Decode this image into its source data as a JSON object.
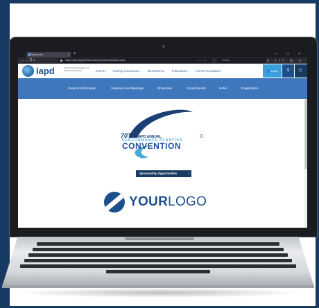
{
  "browser": {
    "tab_title": "Sponsors",
    "tab_close": "×",
    "new_tab": "+",
    "window_controls": "– □ ×",
    "nav_controls": "← → C ⌂",
    "url": "https://iapd.org/2020AnnualConvention/Sponsors.aspx",
    "url_actions": "··· ♡ ☆",
    "search_placeholder": "Search",
    "toolbar_icons": "⇓ ||| ◫ ≡"
  },
  "site": {
    "logo_text": "iapd",
    "org_name": "International Association of Plastics Distribution",
    "menu": [
      "Events ›",
      "Training & Education ›",
      "Membership ›",
      "Publications ›",
      "COVID-19 Updates"
    ],
    "login_label": "👤 Login",
    "search_icon": "⚲",
    "cart_icon": "🛒",
    "nav": [
      "General Information",
      "Sessions and Meetings",
      "Showcase",
      "Social Events",
      "Hotel",
      "Registration"
    ]
  },
  "content": {
    "convention_number": "70TH",
    "convention_line1": "IAPD ANNUAL",
    "convention_line2": "PERFORMANCE PLASTICS",
    "convention_word": "CONVENTION",
    "sponsor_button": "Sponsorship Opportunities",
    "sponsor_arrow": "›",
    "logo_placeholder_a": "YOUR",
    "logo_placeholder_b": "LOGO"
  },
  "colors": {
    "frame": "#173a63",
    "site_nav": "#3f77bd",
    "login": "#3aa0dd",
    "brand": "#1d4f8c"
  }
}
